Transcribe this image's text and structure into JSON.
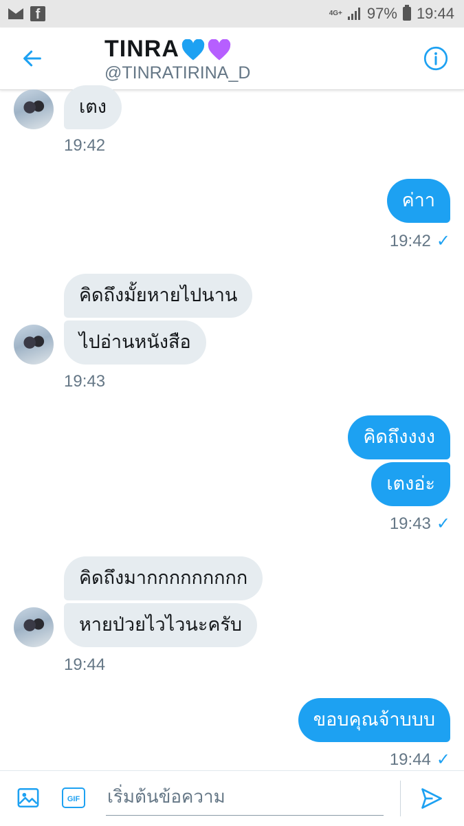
{
  "status_bar": {
    "network": "4G+",
    "battery": "97%",
    "time": "19:44"
  },
  "header": {
    "name": "TINRA",
    "handle": "@TINRATIRINA_D",
    "heart_colors": [
      "#1da1f2",
      "#b65fff"
    ]
  },
  "messages": [
    {
      "direction": "in",
      "text": "เตง",
      "time": "19:42"
    },
    {
      "direction": "out",
      "text": "ค่าา",
      "time": "19:42",
      "read": "✓"
    },
    {
      "direction": "in",
      "lines": [
        "คิดถึงมั้ยหายไปนาน",
        "ไปอ่านหนังสือ"
      ],
      "time": "19:43"
    },
    {
      "direction": "out",
      "lines": [
        "คิดถึงงงง",
        "เตงอ่ะ"
      ],
      "time": "19:43",
      "read": "✓"
    },
    {
      "direction": "in",
      "lines": [
        "คิดถึงมากกกกกกกกก",
        "หายป่วยไวไวนะครับ"
      ],
      "time": "19:44"
    },
    {
      "direction": "out",
      "text": "ขอบคุณจ้าบบบ",
      "time": "19:44",
      "read": "✓"
    }
  ],
  "composer": {
    "placeholder": "เริ่มต้นข้อความ",
    "gif_label": "GIF"
  },
  "colors": {
    "accent": "#1da1f2",
    "incoming_bubble": "#e6ecf0",
    "secondary_text": "#657786"
  }
}
